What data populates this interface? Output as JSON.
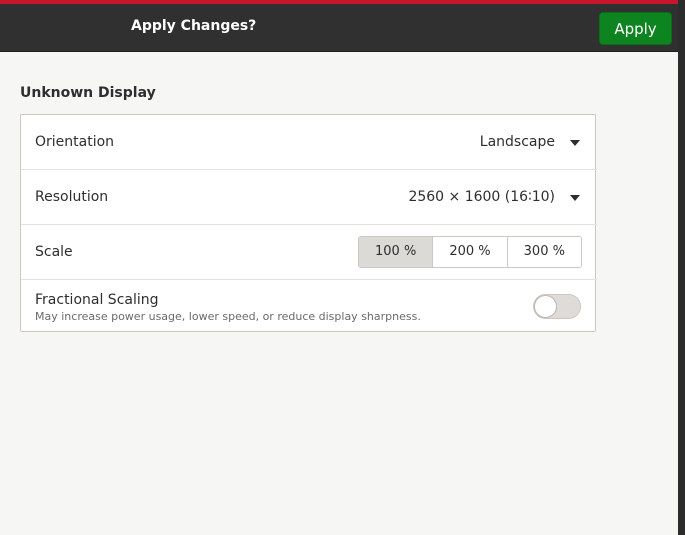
{
  "header": {
    "title": "Apply Changes?",
    "apply_label": "Apply"
  },
  "display": {
    "section_title": "Unknown Display",
    "orientation": {
      "label": "Orientation",
      "value": "Landscape"
    },
    "resolution": {
      "label": "Resolution",
      "value": "2560 × 1600 (16∶10)"
    },
    "scale": {
      "label": "Scale",
      "options": [
        "100 %",
        "200 %",
        "300 %"
      ],
      "selected": "100 %"
    },
    "fractional_scaling": {
      "label": "Fractional Scaling",
      "description": "May increase power usage, lower speed, or reduce display sharpness.",
      "enabled": false
    }
  },
  "colors": {
    "accent_green": "#0e8420",
    "header_bg": "#303030",
    "window_edge_red": "#c7162b"
  }
}
